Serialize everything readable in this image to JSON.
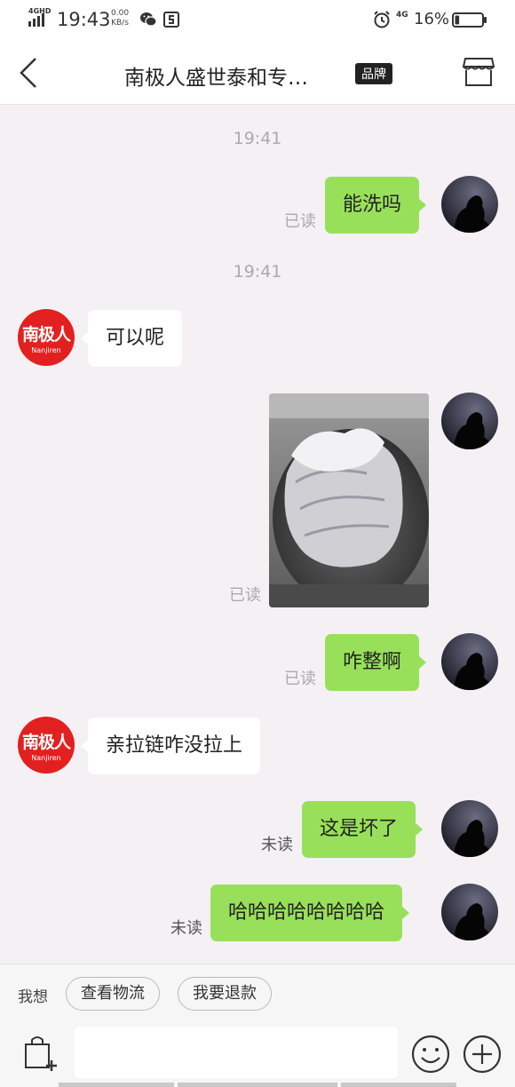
{
  "status_bar": {
    "network": "4GHD",
    "time": "19:43",
    "speed_value": "0.00",
    "speed_unit": "KB/s",
    "mobile": "4G",
    "battery_percent": "16%",
    "battery_level": 0.16
  },
  "header": {
    "title": "南极人盛世泰和专…",
    "badge": "品牌"
  },
  "shop_avatar": {
    "cn": "南极人",
    "en": "Nanjiren"
  },
  "messages": [
    {
      "type": "timestamp",
      "text": "19:41"
    },
    {
      "type": "out",
      "text": "能洗吗",
      "status": "已读"
    },
    {
      "type": "timestamp",
      "text": "19:41"
    },
    {
      "type": "in",
      "text": "可以呢"
    },
    {
      "type": "out-image",
      "status": "已读"
    },
    {
      "type": "out",
      "text": "咋整啊",
      "status": "已读"
    },
    {
      "type": "in",
      "text": "亲拉链咋没拉上"
    },
    {
      "type": "out",
      "text": "这是坏了",
      "status": "未读"
    },
    {
      "type": "out",
      "text": "哈哈哈哈哈哈哈哈",
      "status": "未读"
    }
  ],
  "quick_actions": {
    "label": "我想",
    "chips": [
      "查看物流",
      "我要退款"
    ]
  },
  "input": {
    "placeholder": ""
  },
  "icons": {
    "back": "back-chevron-icon",
    "store": "store-icon",
    "bag": "shopping-bag-add-icon",
    "emoji": "emoji-icon",
    "plus": "plus-icon"
  },
  "colors": {
    "outgoing_bubble": "#99e05a",
    "incoming_bubble": "#ffffff",
    "chat_background": "#f4f0f4",
    "brand_red": "#e32020"
  }
}
